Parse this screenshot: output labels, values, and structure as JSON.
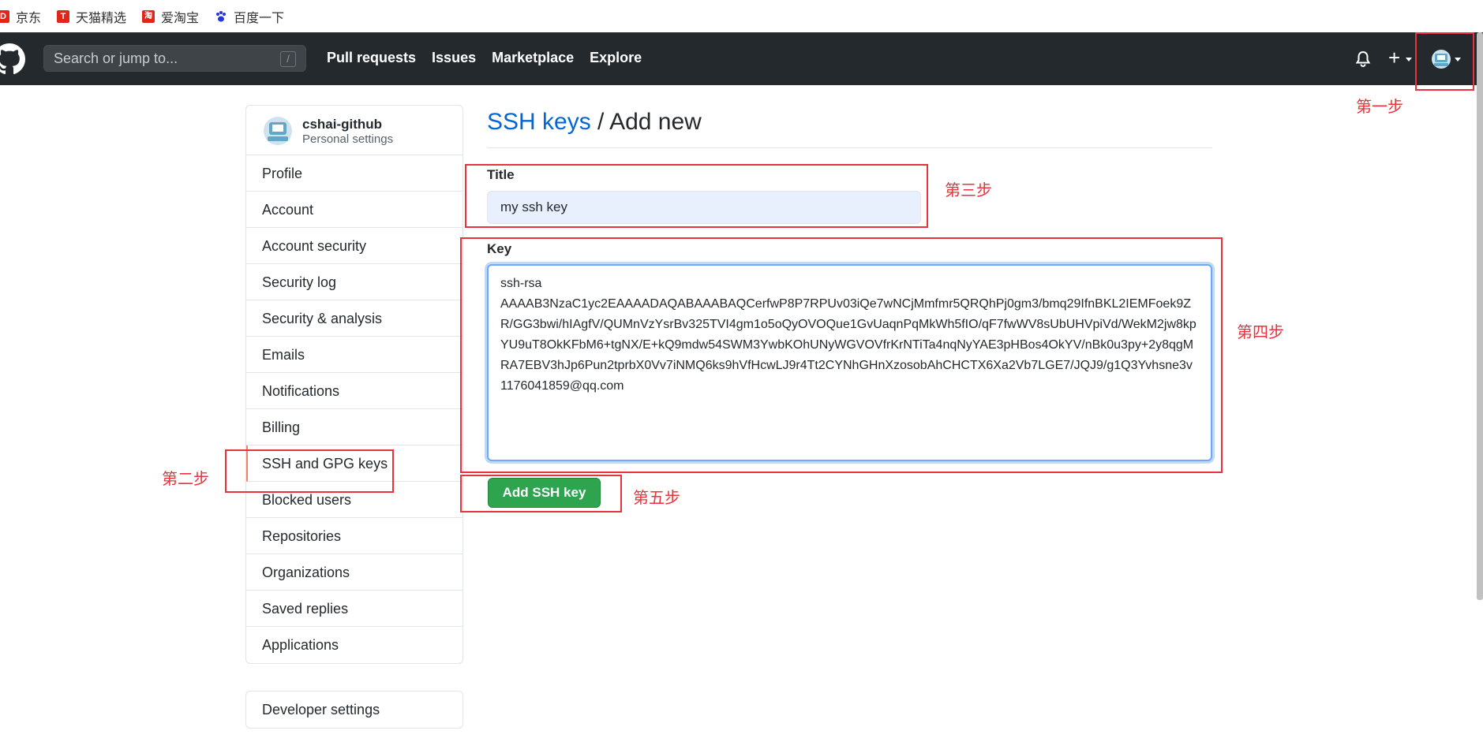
{
  "bookmarks": [
    {
      "label": "京东",
      "color": "#e1251b",
      "glyph": "D"
    },
    {
      "label": "天猫精选",
      "color": "#e1251b",
      "glyph": "T"
    },
    {
      "label": "爱淘宝",
      "color": "#e1251b",
      "glyph": "淘"
    },
    {
      "label": "百度一下",
      "color": "#2932e1",
      "glyph": "paw"
    }
  ],
  "header": {
    "search_placeholder": "Search or jump to...",
    "slash": "/",
    "nav": [
      "Pull requests",
      "Issues",
      "Marketplace",
      "Explore"
    ],
    "plus": "+"
  },
  "sidebar": {
    "username": "cshai-github",
    "subtitle": "Personal settings",
    "items": [
      {
        "label": "Profile"
      },
      {
        "label": "Account"
      },
      {
        "label": "Account security"
      },
      {
        "label": "Security log"
      },
      {
        "label": "Security & analysis"
      },
      {
        "label": "Emails"
      },
      {
        "label": "Notifications"
      },
      {
        "label": "Billing"
      },
      {
        "label": "SSH and GPG keys",
        "active": true
      },
      {
        "label": "Blocked users"
      },
      {
        "label": "Repositories"
      },
      {
        "label": "Organizations"
      },
      {
        "label": "Saved replies"
      },
      {
        "label": "Applications"
      }
    ],
    "developer_settings": "Developer settings"
  },
  "main": {
    "breadcrumb_link": "SSH keys",
    "breadcrumb_sep": " / ",
    "breadcrumb_current": "Add new",
    "title_label": "Title",
    "title_value": "my ssh key",
    "key_label": "Key",
    "key_value": "ssh-rsa\nAAAAB3NzaC1yc2EAAAADAQABAAABAQCerfwP8P7RPUv03iQe7wNCjMmfmr5QRQhPj0gm3/bmq29IfnBKL2IEMFoek9ZR/GG3bwi/hIAgfV/QUMnVzYsrBv325TVI4gm1o5oQyOVOQue1GvUaqnPqMkWh5fIO/qF7fwWV8sUbUHVpiVd/WekM2jw8kpYU9uT8OkKFbM6+tgNX/E+kQ9mdw54SWM3YwbKOhUNyWGVOVfrKrNTiTa4nqNyYAE3pHBos4OkYV/nBk0u3py+2y8qgMRA7EBV3hJp6Pun2tprbX0Vv7iNMQ6ks9hVfHcwLJ9r4Tt2CYNhGHnXzosobAhCHCTX6Xa2Vb7LGE7/JQJ9/g1Q3Yvhsne3v 1176041859@qq.com",
    "add_button": "Add SSH key"
  },
  "annotations": {
    "step1": "第一步",
    "step2": "第二步",
    "step3": "第三步",
    "step4": "第四步",
    "step5": "第五步",
    "color": "#e8333c"
  }
}
